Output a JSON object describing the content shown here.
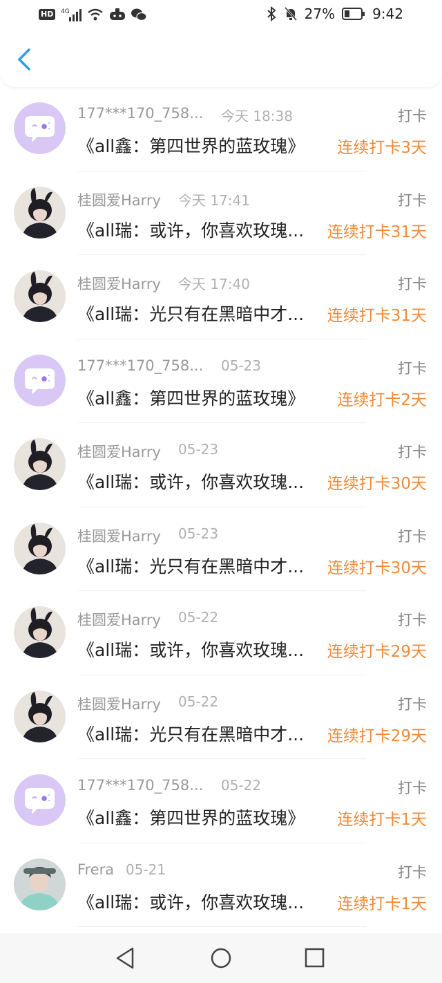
{
  "status_bar": {
    "network": "4G",
    "hd": "HD",
    "battery": "27%",
    "time": "9:42"
  },
  "nav": {
    "back_icon": "chevron-left-icon"
  },
  "colors": {
    "accent": "#2f9be8",
    "streak": "#f08a3a",
    "avatar_purple": "#d9c7f5"
  },
  "items": [
    {
      "name": "177***170_758...",
      "time": "今天 18:38",
      "tag": "打卡",
      "title": "《all鑫：第四世界的蓝玫瑰》",
      "streak": "连续打卡3天",
      "avatar": "purple-chat"
    },
    {
      "name": "桂圆爱Harry",
      "time": "今天 17:41",
      "tag": "打卡",
      "title": "《all瑞：或许，你喜欢玫瑰...",
      "streak": "连续打卡31天",
      "avatar": "photo-bunny"
    },
    {
      "name": "桂圆爱Harry",
      "time": "今天 17:40",
      "tag": "打卡",
      "title": "《all瑞：光只有在黑暗中才...",
      "streak": "连续打卡31天",
      "avatar": "photo-bunny"
    },
    {
      "name": "177***170_758...",
      "time": "05-23",
      "tag": "打卡",
      "title": "《all鑫：第四世界的蓝玫瑰》",
      "streak": "连续打卡2天",
      "avatar": "purple-chat"
    },
    {
      "name": "桂圆爱Harry",
      "time": "05-23",
      "tag": "打卡",
      "title": "《all瑞：或许，你喜欢玫瑰...",
      "streak": "连续打卡30天",
      "avatar": "photo-bunny"
    },
    {
      "name": "桂圆爱Harry",
      "time": "05-23",
      "tag": "打卡",
      "title": "《all瑞：光只有在黑暗中才...",
      "streak": "连续打卡30天",
      "avatar": "photo-bunny"
    },
    {
      "name": "桂圆爱Harry",
      "time": "05-22",
      "tag": "打卡",
      "title": "《all瑞：或许，你喜欢玫瑰...",
      "streak": "连续打卡29天",
      "avatar": "photo-bunny"
    },
    {
      "name": "桂圆爱Harry",
      "time": "05-22",
      "tag": "打卡",
      "title": "《all瑞：光只有在黑暗中才...",
      "streak": "连续打卡29天",
      "avatar": "photo-bunny"
    },
    {
      "name": "177***170_758...",
      "time": "05-22",
      "tag": "打卡",
      "title": "《all鑫：第四世界的蓝玫瑰》",
      "streak": "连续打卡1天",
      "avatar": "purple-chat"
    },
    {
      "name": "Frera",
      "time": "05-21",
      "tag": "打卡",
      "title": "《all瑞：或许，你喜欢玫瑰...",
      "streak": "连续打卡1天",
      "avatar": "photo-hoodie"
    }
  ],
  "bottom_nav": {
    "back": "triangle-back-icon",
    "home": "circle-home-icon",
    "recents": "square-recents-icon"
  }
}
